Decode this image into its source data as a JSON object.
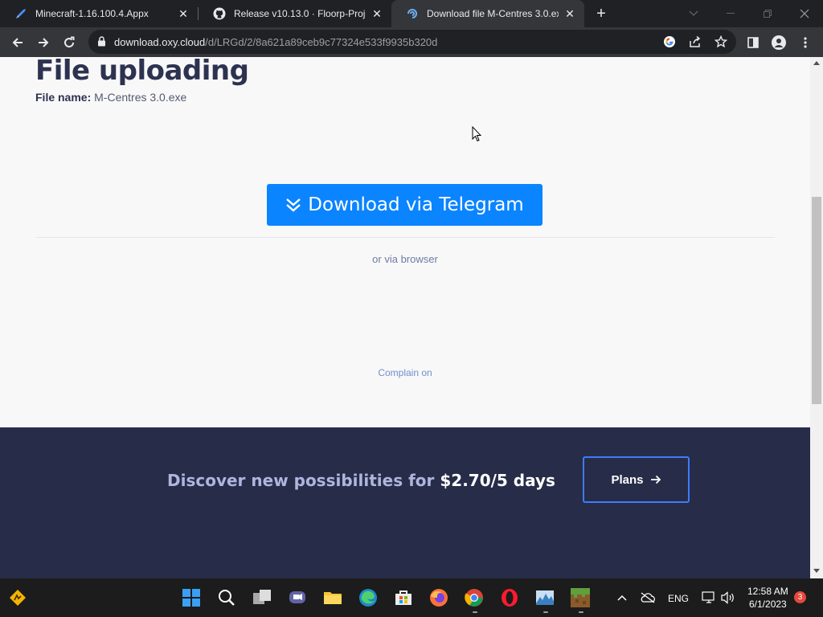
{
  "browser": {
    "tabs": [
      {
        "title": "Minecraft-1.16.100.4.Appx",
        "icon": "rocket-icon",
        "active": false
      },
      {
        "title": "Release v10.13.0 · Floorp-Project",
        "icon": "github-icon",
        "active": false
      },
      {
        "title": "Download file M-Centres 3.0.exe",
        "icon": "oxy-cloud-icon",
        "active": true
      }
    ],
    "address_bar": {
      "host": "download.oxy.cloud",
      "path": "/d/LRGd/2/8a621a89ceb9c77324e533f9935b320d"
    }
  },
  "page": {
    "heading": "File uploading",
    "file_name_label": "File name:",
    "file_name_value": "M-Centres 3.0.exe",
    "download_button_label": "Download via Telegram",
    "alt_download_link": "or via browser",
    "complain_link": "Complain on",
    "promo_text": "Discover new possibilities for",
    "promo_price": "$2.70/5 days",
    "plans_button_label": "Plans"
  },
  "taskbar": {
    "apps": [
      "widgets-icon",
      "start-icon",
      "search-icon",
      "task-view-icon",
      "chat-icon",
      "file-explorer-icon",
      "edge-icon",
      "store-icon",
      "firefox-icon",
      "chrome-icon",
      "opera-icon",
      "photos-icon",
      "minecraft-icon"
    ],
    "language": "ENG",
    "time": "12:58 AM",
    "date": "6/1/2023",
    "notification_count": "3"
  },
  "colors": {
    "accent_button": "#0b84ff",
    "footer_bg": "#272c48",
    "heading": "#2d3250"
  }
}
